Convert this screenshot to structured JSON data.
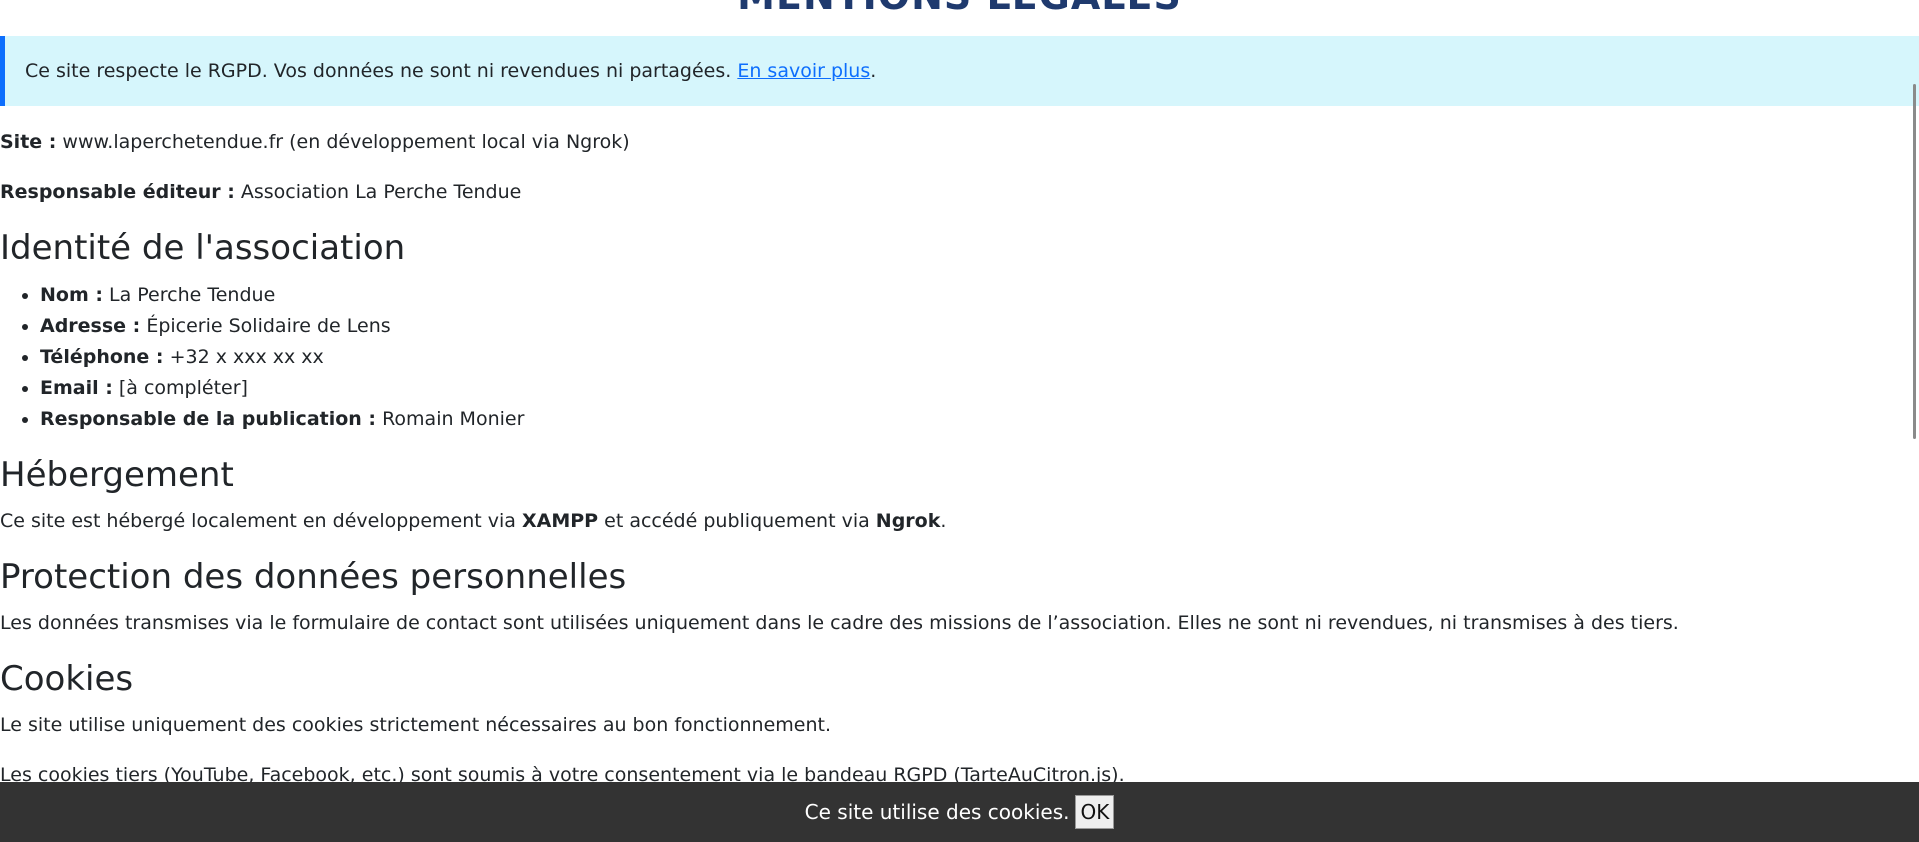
{
  "header": {
    "title": "MENTIONS LÉGALES"
  },
  "rgpd_banner": {
    "text": "Ce site respecte le RGPD. Vos données ne sont ni revendues ni partagées. ",
    "link_label": "En savoir plus",
    "suffix": "."
  },
  "site_info": {
    "site_label": "Site :",
    "site_value": " www.laperchetendue.fr (en développement local via Ngrok)",
    "editor_label": "Responsable éditeur :",
    "editor_value": " Association La Perche Tendue"
  },
  "identity": {
    "heading": "Identité de l'association",
    "items": [
      {
        "label": "Nom :",
        "value": " La Perche Tendue"
      },
      {
        "label": "Adresse :",
        "value": " Épicerie Solidaire de Lens"
      },
      {
        "label": "Téléphone :",
        "value": " +32 x xxx xx xx"
      },
      {
        "label": "Email :",
        "value": " [à compléter]"
      },
      {
        "label": "Responsable de la publication :",
        "value": " Romain Monier"
      }
    ]
  },
  "hosting": {
    "heading": "Hébergement",
    "text_before": "Ce site est hébergé localement en développement via ",
    "bold1": "XAMPP",
    "text_middle": " et accédé publiquement via ",
    "bold2": "Ngrok",
    "text_after": "."
  },
  "data_protection": {
    "heading": "Protection des données personnelles",
    "text": "Les données transmises via le formulaire de contact sont utilisées uniquement dans le cadre des missions de l’association. Elles ne sont ni revendues, ni transmises à des tiers."
  },
  "cookies": {
    "heading": "Cookies",
    "text1": "Le site utilise uniquement des cookies strictement nécessaires au bon fonctionnement.",
    "text2": "Les cookies tiers (YouTube, Facebook, etc.) sont soumis à votre consentement via le bandeau RGPD (TarteAuCitron.js)."
  },
  "cookie_bar": {
    "text": "Ce site utilise des cookies.",
    "ok_label": "OK"
  },
  "colors": {
    "title": "#1f3a6e",
    "banner_bg": "#d6f6fc",
    "banner_accent": "#0d6efd",
    "link": "#0d6efd",
    "cookie_bar_bg": "#333333"
  }
}
